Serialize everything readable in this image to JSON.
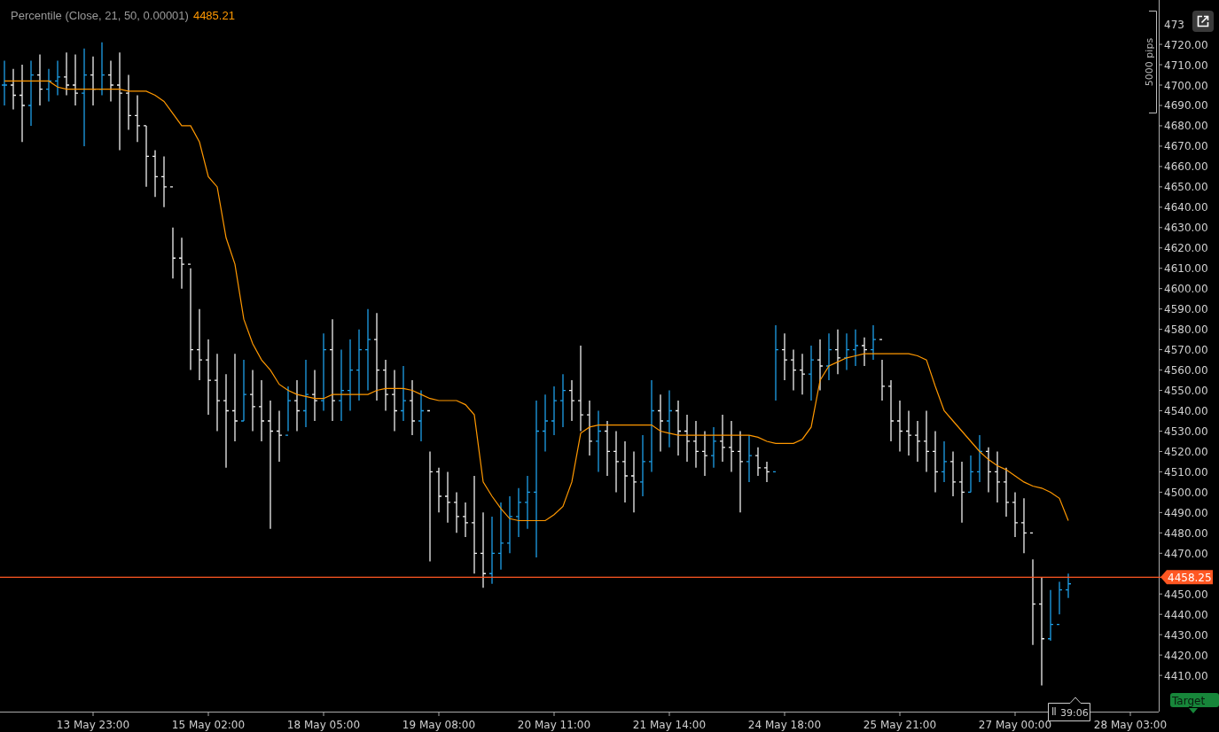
{
  "indicator_value": "4485.21",
  "cut_axis_label": "473",
  "price_marker": {
    "label": "4458.25"
  },
  "chart": {
    "chart_data": {
      "type": "line",
      "categories": [
        null,
        null,
        null,
        null,
        null,
        null,
        null,
        null,
        null,
        null,
        "13 May 23:00",
        null,
        null,
        null,
        null,
        null,
        null,
        null,
        null,
        null,
        null,
        null,
        null,
        "15 May 02:00",
        null,
        null,
        null,
        null,
        null,
        null,
        null,
        null,
        null,
        null,
        null,
        null,
        "18 May 05:00",
        null,
        null,
        null,
        null,
        null,
        null,
        null,
        null,
        null,
        null,
        null,
        null,
        "19 May 08:00",
        null,
        null,
        null,
        null,
        null,
        null,
        null,
        null,
        null,
        null,
        null,
        null,
        "20 May 11:00",
        null,
        null,
        null,
        null,
        null,
        null,
        null,
        null,
        null,
        null,
        null,
        null,
        "21 May 14:00",
        null,
        null,
        null,
        null,
        null,
        null,
        null,
        null,
        null,
        null,
        null,
        null,
        "24 May 18:00",
        null,
        null,
        null,
        null,
        null,
        null,
        null,
        null,
        null,
        null,
        null,
        null,
        "25 May 21:00",
        null,
        null,
        null,
        null,
        null,
        null,
        null,
        null,
        null,
        null,
        null,
        null,
        "27 May 00:00",
        null,
        null,
        null,
        null,
        null,
        null,
        null,
        null,
        null,
        null,
        null,
        null,
        "28 May 03:00"
      ],
      "series": [
        {
          "name": "Percentile (Close, 21, 50, 0.00001)",
          "color": "#ff9800",
          "values": [
            4702,
            4702,
            4702,
            4702,
            4702,
            4702,
            4699,
            4698,
            4698,
            4698,
            4698,
            4698,
            4698,
            4698,
            4697,
            4697,
            4697,
            4695,
            4692,
            4686,
            4680,
            4680,
            4672,
            4655,
            4650,
            4625,
            4612,
            4585,
            4573,
            4565,
            4560,
            4553,
            4550,
            4548,
            4547,
            4546,
            4546,
            4548,
            4548,
            4548,
            4548,
            4548,
            4550,
            4551,
            4551,
            4551,
            4550,
            4548,
            4546,
            4545,
            4545,
            4545,
            4543,
            4538,
            4505,
            4498,
            4492,
            4487,
            4486,
            4486,
            4486,
            4486,
            4489,
            4493,
            4505,
            4529,
            4532,
            4533,
            4533,
            4533,
            4533,
            4533,
            4533,
            4533,
            4530,
            4529,
            4528,
            4528,
            4528,
            4528,
            4528,
            4528,
            4528,
            4528,
            4528,
            4527,
            4525,
            4524,
            4524,
            4524,
            4526,
            4532,
            4555,
            4562,
            4564,
            4566,
            4567,
            4568,
            4568,
            4568,
            4568,
            4568,
            4568,
            4567,
            4565,
            4552,
            4540,
            4535,
            4530,
            4525,
            4520,
            4516,
            4513,
            4511,
            4508,
            4505,
            4503,
            4502,
            4500,
            4497,
            4486,
            null,
            null,
            null,
            null,
            null,
            null,
            null
          ]
        }
      ],
      "ylim": [
        4392.2,
        4741.8
      ],
      "yticks": [
        {
          "value": 4720,
          "label": "4720.00"
        },
        {
          "value": 4710,
          "label": "4710.00"
        },
        {
          "value": 4700,
          "label": "4700.00"
        },
        {
          "value": 4690,
          "label": "4690.00"
        },
        {
          "value": 4680,
          "label": "4680.00"
        },
        {
          "value": 4670,
          "label": "4670.00"
        },
        {
          "value": 4660,
          "label": "4660.00"
        },
        {
          "value": 4650,
          "label": "4650.00"
        },
        {
          "value": 4640,
          "label": "4640.00"
        },
        {
          "value": 4630,
          "label": "4630.00"
        },
        {
          "value": 4620,
          "label": "4620.00"
        },
        {
          "value": 4610,
          "label": "4610.00"
        },
        {
          "value": 4600,
          "label": "4600.00"
        },
        {
          "value": 4590,
          "label": "4590.00"
        },
        {
          "value": 4580,
          "label": "4580.00"
        },
        {
          "value": 4570,
          "label": "4570.00"
        },
        {
          "value": 4560,
          "label": "4560.00"
        },
        {
          "value": 4550,
          "label": "4550.00"
        },
        {
          "value": 4540,
          "label": "4540.00"
        },
        {
          "value": 4530,
          "label": "4530.00"
        },
        {
          "value": 4520,
          "label": "4520.00"
        },
        {
          "value": 4510,
          "label": "4510.00"
        },
        {
          "value": 4500,
          "label": "4500.00"
        },
        {
          "value": 4490,
          "label": "4490.00"
        },
        {
          "value": 4480,
          "label": "4480.00"
        },
        {
          "value": 4470,
          "label": "4470.00"
        },
        {
          "value": 4450,
          "label": "4450.00"
        },
        {
          "value": 4440,
          "label": "4440.00"
        },
        {
          "value": 4430,
          "label": "4430.00"
        },
        {
          "value": 4420,
          "label": "4420.00"
        },
        {
          "value": 4410,
          "label": "4410.00"
        }
      ]
    }
  },
  "ruler_label": "5000 pips",
  "countdown": "39:06",
  "target_label": "Target"
}
